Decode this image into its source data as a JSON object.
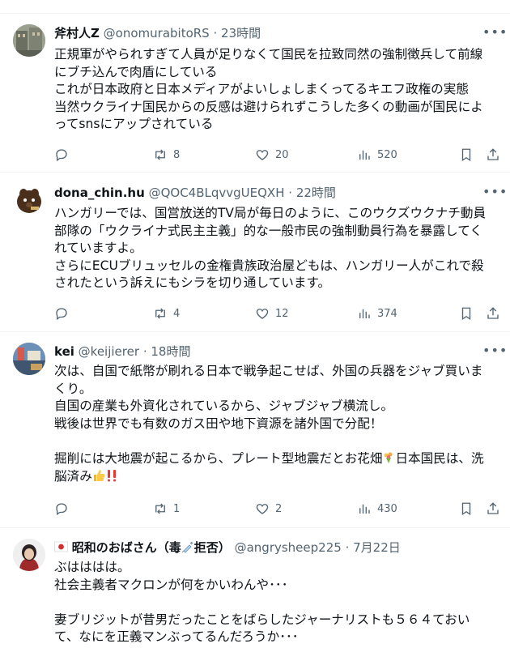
{
  "tweets": [
    {
      "name": "斧村人Z",
      "handle": "@onomurabitoRS",
      "dot": "·",
      "time": "23時間",
      "text": "正規軍がやられすぎて人員が足りなくて国民を拉致同然の強制徴兵して前線\nにブチ込んで肉盾にしている\nこれが日本政府と日本メディアがよいしょしまくってるキエフ政権の実態\n当然ウクライナ国民からの反感は避けられずこうした多くの動画が国民によ\nってsnsにアップされている",
      "retweets": "8",
      "likes": "20",
      "views": "520"
    },
    {
      "name": "dona_chin.hu",
      "handle": "@QOC4BLqvvgUEQXH",
      "dot": "·",
      "time": "22時間",
      "text": "ハンガリーでは、国営放送的TV局が毎日のように、このウクズウクナチ動員\n部隊の「ウクライナ式民主主義」的な一般市民の強制動員行為を暴露してく\nれていますよ。\nさらにECUブリュッセルの金権貴族政治屋どもは、ハンガリー人がこれで殺\nされたという訴えにもシラを切り通しています。",
      "retweets": "4",
      "likes": "12",
      "views": "374"
    },
    {
      "name": "kei",
      "handle": "@keijierer",
      "dot": "·",
      "time": "18時間",
      "text_a": "次は、自国で紙幣が刷れる日本で戦争起こせば、外国の兵器をジャブ買いま\nくり。\n自国の産業も外資化されているから、ジャブジャブ横流し。\n戦後は世界でも有数のガス田や地下資源を諸外国で分配！\n\n掘削には大地震が起こるから、プレート型地震だとお花畑",
      "text_b": "日本国民は、洗\n脳済み",
      "retweets": "1",
      "likes": "2",
      "views": "430"
    },
    {
      "name_a": "昭和のおばさん（毒",
      "name_b": "拒否）",
      "handle": "@angrysheep225",
      "dot": "·",
      "time": "7月22日",
      "text": "ぶはははは。\n社会主義者マクロンが何をかいわんや･･･\n\n妻ブリジットが昔男だったことをばらしたジャーナリストも５６４ておい\nて、なにを正義マンぶってるんだろうか･･･"
    }
  ],
  "icons": [
    "more-icon",
    "reply-icon",
    "retweet-icon",
    "like-icon",
    "views-icon",
    "bookmark-icon",
    "share-icon",
    "bouquet-emoji",
    "thumbs-up-emoji",
    "double-exclamation-emoji",
    "japan-flag-emoji",
    "syringe-emoji"
  ]
}
